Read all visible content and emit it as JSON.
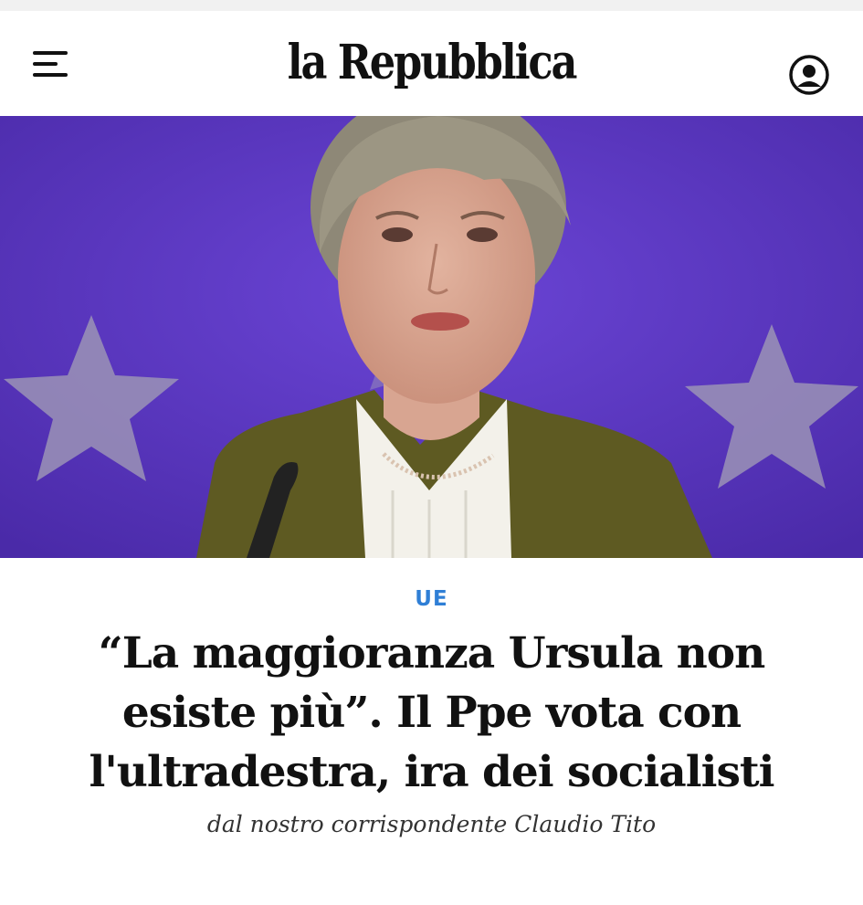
{
  "header": {
    "logo": "la Repubblica",
    "menu_icon": "hamburger-menu-icon",
    "account_icon": "user-account-icon"
  },
  "hero": {
    "image": "photo-woman-speaking-eu-flag-background",
    "colors": {
      "flag_background": "#5a36c4",
      "jacket": "#5e5a22"
    }
  },
  "article": {
    "section": "UE",
    "headline": "“La maggioranza Ursula non esiste più”. Il Ppe vota con l'ultradestra, ira dei socialisti",
    "byline": "dal nostro corrispondente Claudio Tito"
  },
  "colors": {
    "section": "#2f7fd6",
    "text": "#111111"
  }
}
